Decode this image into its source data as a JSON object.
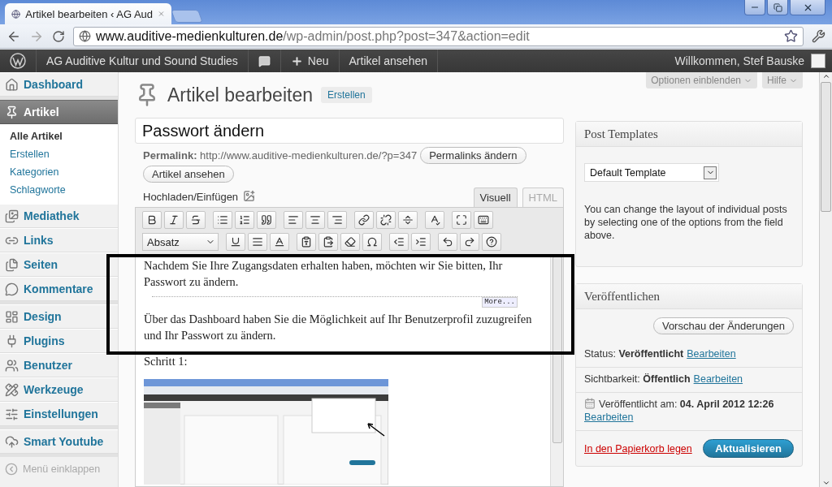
{
  "browser": {
    "tab_title": "Artikel bearbeiten ‹ AG Aud",
    "url_host": "www.auditive-medienkulturen.de",
    "url_path": "/wp-admin/post.php?post=347&action=edit"
  },
  "admin_bar": {
    "site": "AG Auditive Kultur und Sound Studies",
    "new": "Neu",
    "view": "Artikel ansehen",
    "greeting": "Willkommen, Stef Bauske"
  },
  "sidebar": {
    "groups": [
      [
        {
          "label": "Dashboard",
          "selected": false
        }
      ],
      [
        {
          "label": "Artikel",
          "selected": true,
          "children": [
            {
              "label": "Alle Artikel",
              "selected": true
            },
            {
              "label": "Erstellen",
              "selected": false
            },
            {
              "label": "Kategorien",
              "selected": false
            },
            {
              "label": "Schlagworte",
              "selected": false
            }
          ]
        },
        {
          "label": "Mediathek",
          "selected": false
        },
        {
          "label": "Links",
          "selected": false
        },
        {
          "label": "Seiten",
          "selected": false
        },
        {
          "label": "Kommentare",
          "selected": false
        }
      ],
      [
        {
          "label": "Design",
          "selected": false
        },
        {
          "label": "Plugins",
          "selected": false
        },
        {
          "label": "Benutzer",
          "selected": false
        },
        {
          "label": "Werkzeuge",
          "selected": false
        },
        {
          "label": "Einstellungen",
          "selected": false
        }
      ],
      [
        {
          "label": "Smart Youtube",
          "selected": false
        }
      ]
    ],
    "collapse": "Menü einklappen"
  },
  "screen_meta": {
    "options": "Optionen einblenden",
    "help": "Hilfe"
  },
  "editor": {
    "heading": "Artikel bearbeiten",
    "add_new": "Erstellen",
    "post_title": "Passwort ändern",
    "permalink_label": "Permalink:",
    "permalink_url": "http://www.auditive-medienkulturen.de/?p=347",
    "permalink_button": "Permalinks ändern",
    "view_button": "Artikel ansehen",
    "upload_label": "Hochladen/Einfügen",
    "tabs": [
      {
        "label": "Visuell",
        "selected": true
      },
      {
        "label": "HTML",
        "selected": false
      }
    ],
    "format": "Absatz",
    "content": [
      {
        "kind": "text",
        "text": "Nachdem Sie Ihre Zugangsdaten erhalten haben, möchten wir Sie bitten, Ihr Passwort zu ändern."
      },
      {
        "kind": "more",
        "text": "More..."
      },
      {
        "kind": "text",
        "text": "Über das Dashboard haben Sie die Möglichkeit auf Ihr Benutzerprofil zuzugreifen und Ihr Passwort zu ändern."
      },
      {
        "kind": "text",
        "text": "Schritt 1:"
      },
      {
        "kind": "screenshot"
      }
    ]
  },
  "post_templates": {
    "title": "Post Templates",
    "template": "Default Template",
    "description": "You can change the layout of individual posts by selecting one of the options from the field above."
  },
  "publish": {
    "title": "Veröffentlichen",
    "preview": "Vorschau der Änderungen",
    "rows": [
      {
        "kind": "status",
        "text": "Status: **Veröffentlicht**",
        "link": "Bearbeiten"
      },
      {
        "kind": "visibility",
        "text": "Sichtbarkeit: **Öffentlich**",
        "link": "Bearbeiten"
      },
      {
        "kind": "date",
        "text": "Veröffentlicht am: **04. April 2012 12:26**",
        "link": "Bearbeiten"
      }
    ],
    "trash": "In den Papierkorb legen",
    "update": "Aktualisieren"
  }
}
